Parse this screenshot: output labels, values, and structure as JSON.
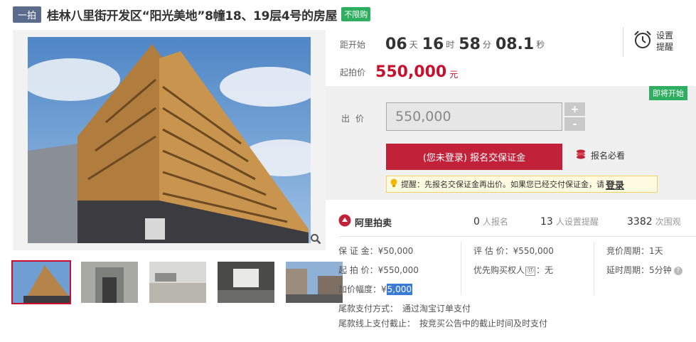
{
  "header": {
    "round_badge": "一拍",
    "title": "桂林八里街开发区“阳光美地”8幢18、19层4号的房屋",
    "limit_badge": "不限购"
  },
  "countdown": {
    "label": "距开始",
    "days": "06",
    "days_unit": "天",
    "hours": "16",
    "hours_unit": "时",
    "minutes": "58",
    "minutes_unit": "分",
    "seconds": "08.1",
    "seconds_unit": "秒"
  },
  "reminder": {
    "label": "设置提醒",
    "icon": "alarm-clock-icon"
  },
  "start_price": {
    "label": "起拍价",
    "value": "550,000",
    "unit": "元"
  },
  "bid": {
    "soon_badge": "即将开始",
    "label": "出价",
    "input_placeholder": "550,000",
    "plus": "+",
    "minus": "-",
    "deposit_button": "(您未登录) 报名交保证金",
    "must_read": "报名必看",
    "tip_text": "提醒：先报名交保证金再出价。如果您已经交付保证金，请",
    "tip_login": "登录"
  },
  "ali": {
    "logo_text": "阿里拍卖",
    "signups_count": "0",
    "signups_label": "人报名",
    "reminders_count": "13",
    "reminders_label": "人设置提醒",
    "views_count": "3382",
    "views_label": "次围观"
  },
  "details": {
    "deposit_label": "保 证 金：",
    "deposit_value": "¥50,000",
    "start_label": "起 拍 价：",
    "start_value": "¥550,000",
    "increment_label": "加价幅度：",
    "increment_prefix": "¥",
    "increment_value": "5,000",
    "appraisal_label": "评 估 价：",
    "appraisal_value": "¥550,000",
    "priority_label": "优先购买权人",
    "priority_mark": "⑰",
    "priority_value": "：无",
    "cycle_label": "竞价周期：",
    "cycle_value": "1天",
    "delay_label": "延时周期：",
    "delay_value": "5分钟",
    "payment_method_label": "尾款支付方式：",
    "payment_method_value": "通过淘宝订单支付",
    "payment_deadline_label": "尾款线上支付截止：",
    "payment_deadline_value": "按竞买公告中的截止时间及时支付"
  },
  "colors": {
    "accent_red": "#c2213a",
    "green_badge": "#2eae5f",
    "round_badge": "#5b6b8c"
  }
}
